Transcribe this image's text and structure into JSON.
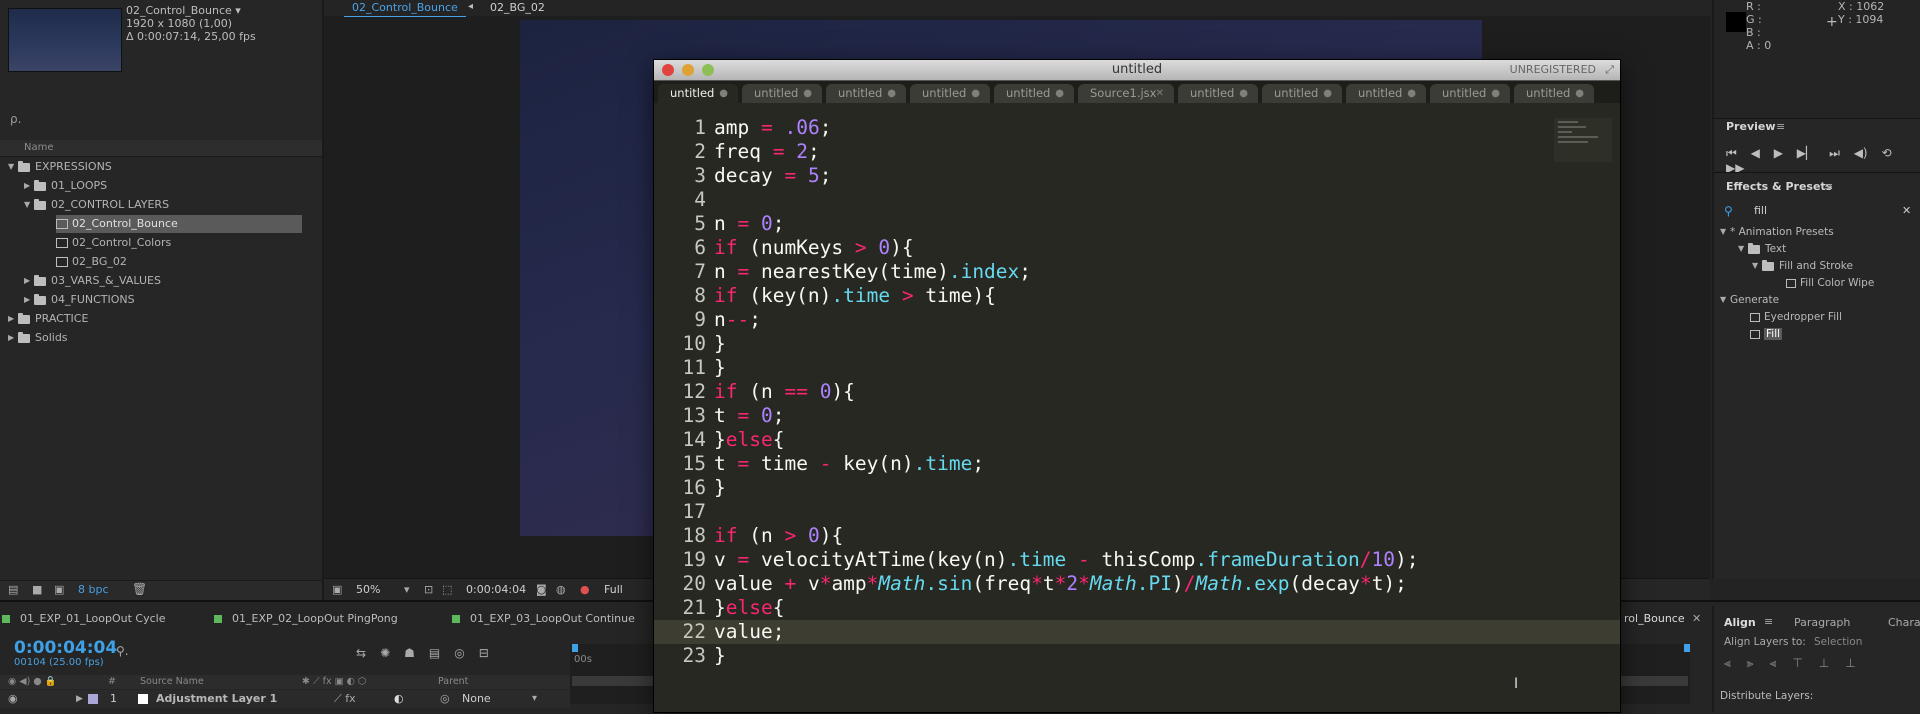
{
  "project": {
    "comp_name": "02_Control_Bounce ▾",
    "comp_size": "1920 x 1080 (1,00)",
    "comp_duration": "Δ 0:00:07:14, 25,00 fps",
    "search_placeholder": "ρ.",
    "name_header": "Name",
    "tree": [
      {
        "label": "EXPRESSIONS"
      },
      {
        "label": "01_LOOPS"
      },
      {
        "label": "02_CONTROL LAYERS"
      },
      {
        "label": "02_Control_Bounce"
      },
      {
        "label": "02_Control_Colors"
      },
      {
        "label": "02_BG_02"
      },
      {
        "label": "03_VARS_&_VALUES"
      },
      {
        "label": "04_FUNCTIONS"
      },
      {
        "label": "PRACTICE"
      },
      {
        "label": "Solids"
      }
    ],
    "bpc": "8 bpc"
  },
  "viewer": {
    "tabs": [
      "02_Control_Bounce",
      "02_BG_02"
    ],
    "zoom": "50%",
    "timecode": "0:00:04:04",
    "resolution": "Full"
  },
  "info": {
    "r": "R :",
    "g": "G :",
    "b": "B :",
    "a": "A : 0",
    "x": "X : 1062",
    "y": "Y : 1094"
  },
  "preview": {
    "title": "Preview",
    "controls": "⏮◀︎▶︎▶︎⏭🔊↻"
  },
  "effects": {
    "title": "Effects & Presets",
    "search": "fill",
    "items": [
      "* Animation Presets",
      "Text",
      "Fill and Stroke",
      "Fill Color Wipe",
      "Generate",
      "Eyedropper Fill",
      "Fill"
    ]
  },
  "timeline": {
    "tabs": [
      "01_EXP_01_LoopOut Cycle",
      "01_EXP_02_LoopOut PingPong",
      "01_EXP_03_LoopOut Continue"
    ],
    "right_tab": "rol_Bounce",
    "timecode": "0:00:04:04",
    "timecode_sub": "00104 (25.00 fps)",
    "col_source": "Source Name",
    "col_parent": "Parent",
    "layer_num": "1",
    "layer_name": "Adjustment Layer 1",
    "layer_parent": "None",
    "ruler_start": "00s"
  },
  "align": {
    "tabs": [
      "Align",
      "Paragraph",
      "Chara"
    ],
    "align_to_label": "Align Layers to:",
    "align_to_value": "Selection",
    "distribute": "Distribute Layers:"
  },
  "editor": {
    "title": "untitled",
    "unregistered": "UNREGISTERED",
    "tabs": [
      "untitled",
      "untitled",
      "untitled",
      "untitled",
      "untitled",
      "Source1.jsx",
      "untitled",
      "untitled",
      "untitled",
      "untitled",
      "untitled"
    ],
    "line_numbers": [
      "1",
      "2",
      "3",
      "4",
      "5",
      "6",
      "7",
      "8",
      "9",
      "10",
      "11",
      "12",
      "13",
      "14",
      "15",
      "16",
      "17",
      "18",
      "19",
      "20",
      "21",
      "22",
      "23"
    ],
    "code_lines": [
      "amp = .06;",
      "freq = 2;",
      "decay = 5;",
      "",
      "n = 0;",
      "if (numKeys > 0){",
      "n = nearestKey(time).index;",
      "if (key(n).time > time){",
      "n--;",
      "}",
      "}",
      "if (n == 0){",
      "t = 0;",
      "}else{",
      "t = time - key(n).time;",
      "}",
      "",
      "if (n > 0){",
      "v = velocityAtTime(key(n).time - thisComp.frameDuration/10);",
      "value + v*amp*Math.sin(freq*t*2*Math.PI)/Math.exp(decay*t);",
      "}else{",
      "value;",
      "}"
    ]
  }
}
